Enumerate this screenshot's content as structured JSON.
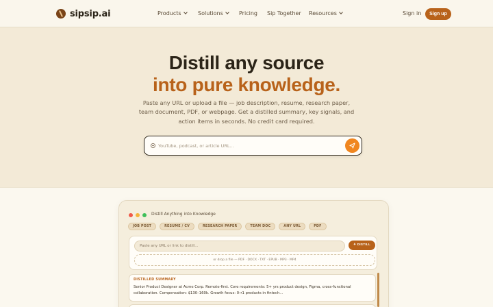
{
  "brand": {
    "name": "sipsip.ai"
  },
  "nav": {
    "items": [
      {
        "label": "Products",
        "has_dropdown": true
      },
      {
        "label": "Solutions",
        "has_dropdown": true
      },
      {
        "label": "Pricing",
        "has_dropdown": false
      },
      {
        "label": "Sip Together",
        "has_dropdown": false
      },
      {
        "label": "Resources",
        "has_dropdown": true
      }
    ],
    "sign_in": "Sign in",
    "sign_up": "Sign up"
  },
  "hero": {
    "title_line1": "Distill any source",
    "title_line2": "into pure knowledge.",
    "subtitle": "Paste any URL or upload a file — job description, resume, research paper, team document, PDF, or webpage. Get a distilled summary, key signals, and action items in seconds. No credit card required.",
    "search_placeholder": "YouTube, podcast, or article URL..."
  },
  "preview": {
    "window_title": "Distill Anything into Knowledge",
    "chips": [
      "JOB POST",
      "RESUME / CV",
      "RESEARCH PAPER",
      "TEAM DOC",
      "ANY URL",
      "PDF"
    ],
    "url_placeholder": "Paste any URL or link to distill...",
    "distill_button": "DISTILL",
    "distill_icon": "sparkle-icon",
    "drop_text": "or drop a file — PDF · DOCX · TXT · EPUB · MP3 · MP4",
    "result_label": "DISTILLED SUMMARY",
    "result_text": "Senior Product Designer at Acme Corp. Remote-first. Core requirements: 5+ yrs product design, Figma, cross-functional collaboration. Compensation: $130–160k. Growth focus: 0→1 products in fintech..."
  },
  "colors": {
    "accent": "#b8621a",
    "accent_bright": "#f0861f",
    "hero_bg": "#f3ead7",
    "page_bg": "#fbf8ef",
    "text_dark": "#2b2418"
  }
}
